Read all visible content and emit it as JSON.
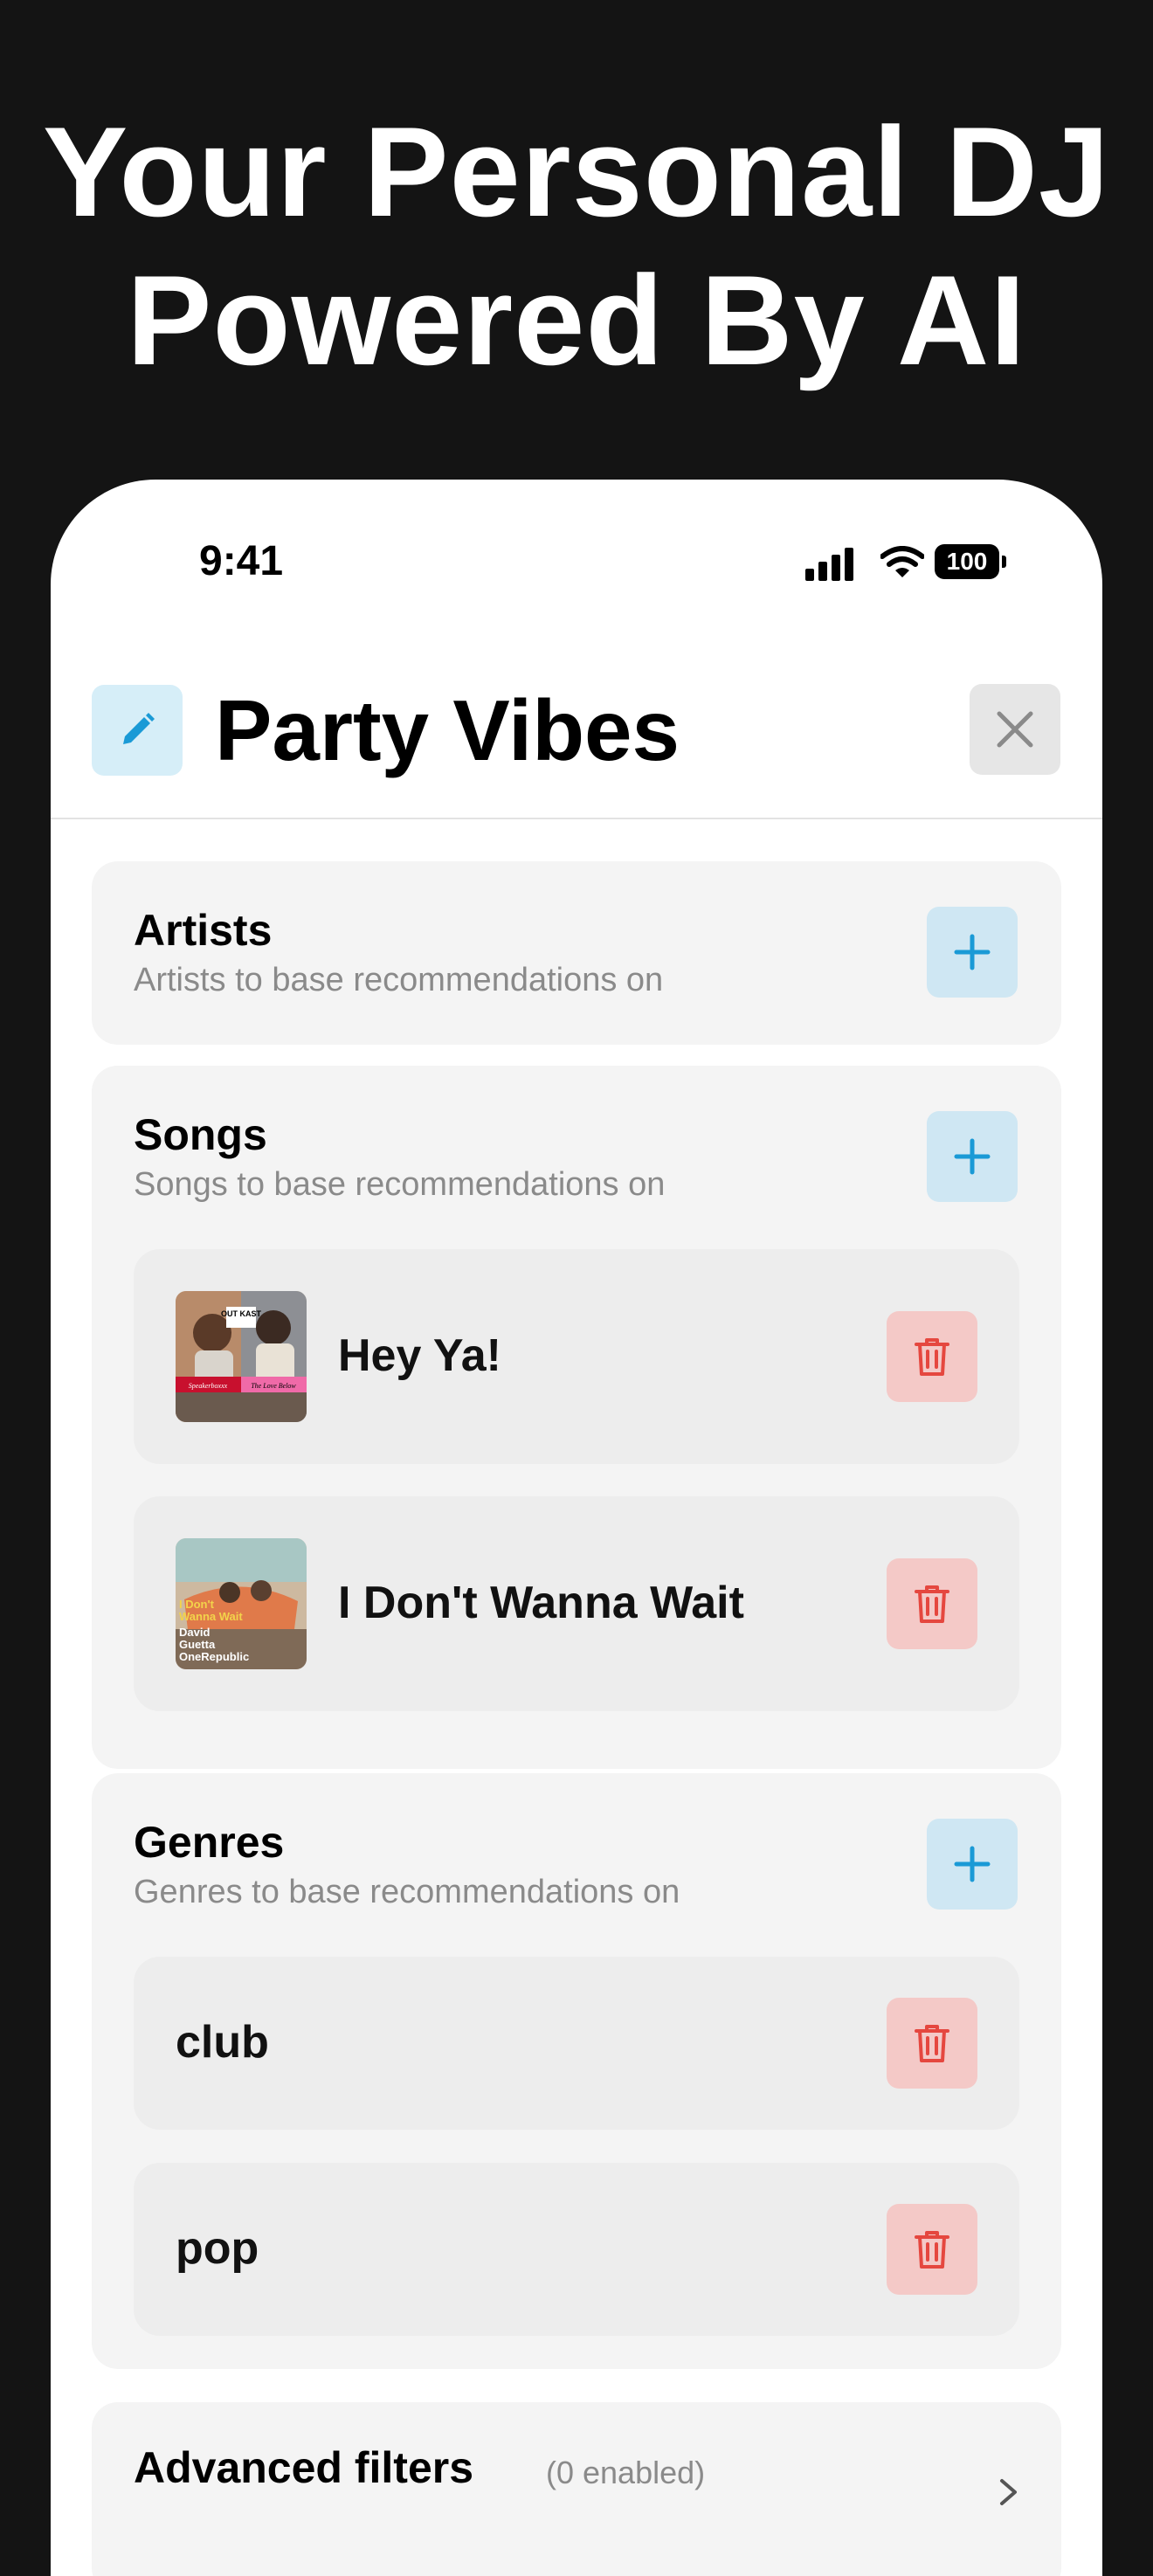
{
  "promo": {
    "headline_line1": "Your Personal DJ",
    "headline_line2": "Powered By AI"
  },
  "status_bar": {
    "time": "9:41",
    "battery": "100"
  },
  "header": {
    "title": "Party Vibes",
    "edit_icon": "pencil-icon",
    "close_icon": "close-icon"
  },
  "sections": {
    "artists": {
      "title": "Artists",
      "subtitle": "Artists to base recommendations on"
    },
    "songs": {
      "title": "Songs",
      "subtitle": "Songs to base recommendations on",
      "items": [
        {
          "label": "Hey Ya!",
          "art": "album-art-outkast"
        },
        {
          "label": "I Don't Wanna Wait",
          "art": "album-art-i-dont-wanna-wait"
        }
      ]
    },
    "genres": {
      "title": "Genres",
      "subtitle": "Genres to base recommendations on",
      "items": [
        {
          "label": "club"
        },
        {
          "label": "pop"
        }
      ]
    },
    "advanced": {
      "title": "Advanced filters",
      "count": "(0 enabled)"
    }
  },
  "art_text": {
    "song1_band": "OUT KAST",
    "song1_left": "Speakerboxxx",
    "song1_right": "The Love Below",
    "song2_lines": [
      "I Don't",
      "Wanna Wait",
      "David",
      "Guetta",
      "OneRepublic"
    ]
  },
  "colors": {
    "background": "#141414",
    "accent_blue": "#1a9ad6",
    "add_button_bg": "#cfe7f3",
    "delete_red": "#e5473f",
    "delete_button_bg": "#f4c9c7"
  }
}
